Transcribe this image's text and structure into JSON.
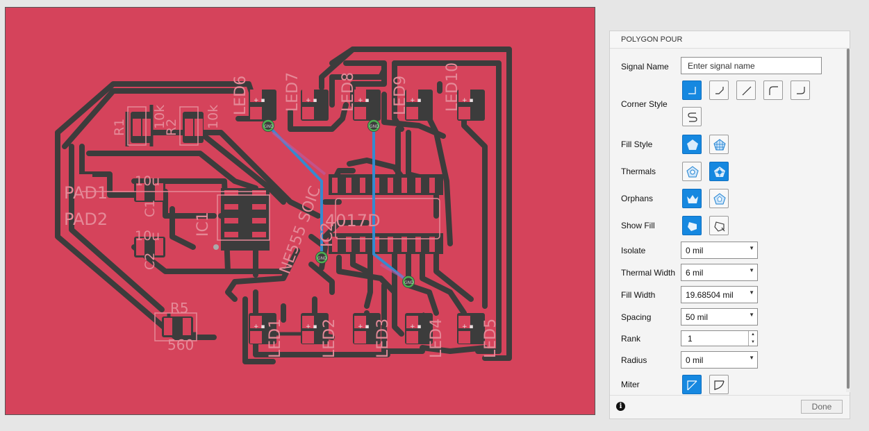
{
  "canvas": {
    "component_labels": [
      "PAD1",
      "PAD2",
      "R1",
      "R2",
      "10k",
      "10k",
      "10u",
      "10u",
      "C1",
      "C2",
      "IC1",
      "IC2",
      "NE555 SOIC",
      "4017D",
      "R5",
      "560",
      "LED1",
      "LED2",
      "LED3",
      "LED4",
      "LED5",
      "LED6",
      "LED7",
      "LED8",
      "LED9",
      "LED10"
    ],
    "via_label": "GND"
  },
  "panel": {
    "title": "POLYGON POUR",
    "signal_name": {
      "label": "Signal Name",
      "placeholder": "Enter signal name",
      "value": ""
    },
    "corner_style": {
      "label": "Corner Style",
      "options": [
        "square",
        "chamfer-short",
        "chamfer-long",
        "round-outer",
        "round-inner",
        "s-curve"
      ],
      "selected": "square"
    },
    "fill_style": {
      "label": "Fill Style",
      "options": [
        "solid",
        "hatch"
      ],
      "selected": "solid"
    },
    "thermals": {
      "label": "Thermals",
      "options": [
        "off",
        "on"
      ],
      "selected": "on"
    },
    "orphans": {
      "label": "Orphans",
      "options": [
        "remove",
        "keep"
      ],
      "selected": "remove"
    },
    "show_fill": {
      "label": "Show Fill",
      "options": [
        "show",
        "hide"
      ],
      "selected": "show"
    },
    "isolate": {
      "label": "Isolate",
      "value": "0 mil"
    },
    "thermal_width": {
      "label": "Thermal Width",
      "value": "6 mil"
    },
    "fill_width": {
      "label": "Fill Width",
      "value": "19.68504 mil"
    },
    "spacing": {
      "label": "Spacing",
      "value": "50 mil"
    },
    "rank": {
      "label": "Rank",
      "value": "1"
    },
    "radius": {
      "label": "Radius",
      "value": "0 mil"
    },
    "miter": {
      "label": "Miter",
      "options": [
        "straight",
        "round"
      ],
      "selected": "straight"
    },
    "done_label": "Done",
    "info_icon": "info-icon"
  },
  "colors": {
    "copper": "#d5435b",
    "trace": "#3c3c3c",
    "accent": "#1688e0",
    "via_ring": "#4caf50",
    "airwire": "#2d8ed6"
  }
}
